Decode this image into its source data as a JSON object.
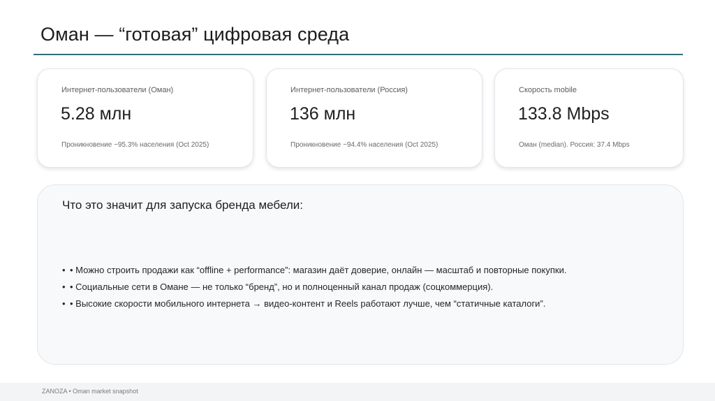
{
  "title": "Оман — “готовая” цифровая среда",
  "stats": [
    {
      "label": "Интернет-пользователи (Оман)",
      "value": "5.28 млн",
      "note": "Проникновение ~95.3% населения (Oct 2025)"
    },
    {
      "label": "Интернет-пользователи (Россия)",
      "value": "136 млн",
      "note": "Проникновение ~94.4% населения (Oct 2025)"
    },
    {
      "label": "Скорость mobile",
      "value": "133.8 Mbps",
      "note": "Оман (median). Россия: 37.4 Mbps"
    }
  ],
  "panel": {
    "heading": "Что это значит для запуска бренда мебели:",
    "bullet_mark": "•",
    "bullets": [
      "• Можно строить продажи как “offline + performance”: магазин даёт доверие, онлайн — масштаб и повторные покупки.",
      "• Социальные сети в Омане — не только “бренд”, но и полноценный канал продаж (соцкоммерция).",
      "• Высокие скорости мобильного интернета → видео-контент и Reels работают лучше, чем “статичные каталоги”."
    ]
  },
  "footer": {
    "text": "ZANOZA • Oman market snapshot"
  },
  "colors": {
    "accent_rule": "#2f6f78",
    "panel_bg": "#f8f9fa",
    "footer_bg": "#f3f4f6"
  }
}
